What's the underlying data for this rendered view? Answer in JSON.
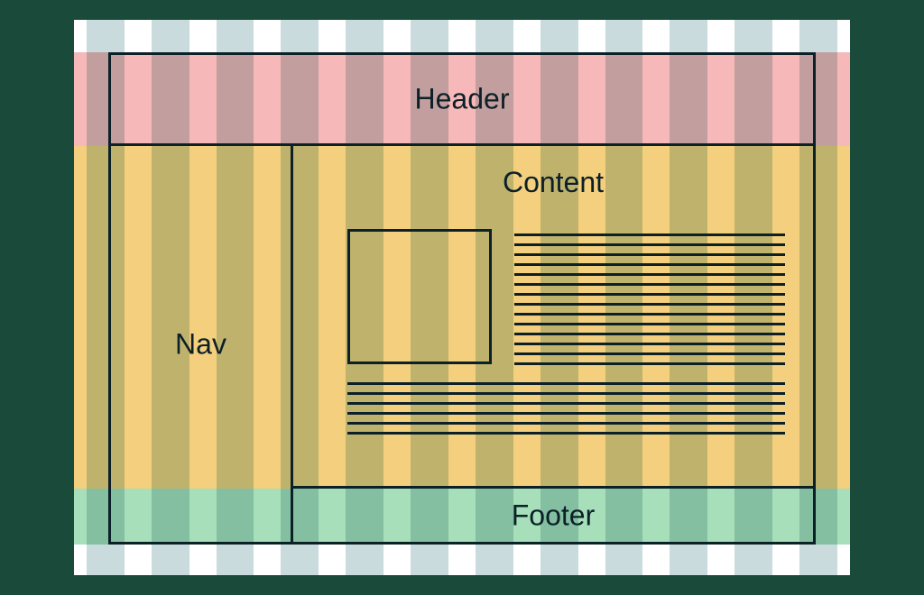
{
  "layout": {
    "header": {
      "label": "Header"
    },
    "nav": {
      "label": "Nav"
    },
    "content": {
      "label": "Content"
    },
    "footer": {
      "label": "Footer"
    }
  },
  "grid": {
    "columns": 12
  },
  "colors": {
    "header_band": "#f6b8b8",
    "middle_band": "#f3cf7e",
    "footer_band": "#a6dfb9",
    "column": "#c9dbdd",
    "stroke": "#0b2027",
    "page_bg": "#1a4a3a"
  }
}
